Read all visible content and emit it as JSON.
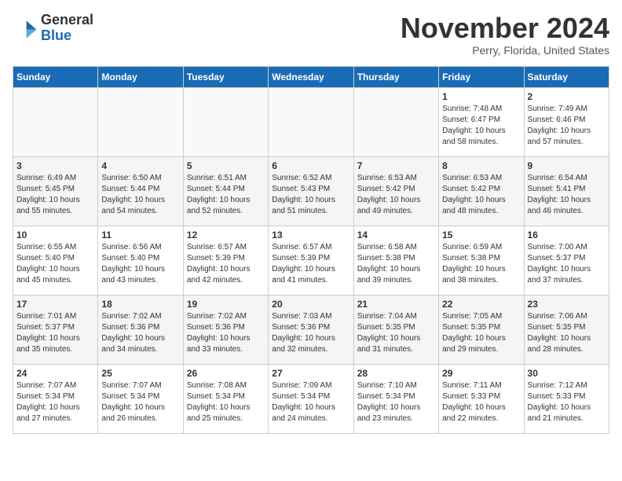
{
  "logo": {
    "general": "General",
    "blue": "Blue"
  },
  "title": "November 2024",
  "location": "Perry, Florida, United States",
  "days_of_week": [
    "Sunday",
    "Monday",
    "Tuesday",
    "Wednesday",
    "Thursday",
    "Friday",
    "Saturday"
  ],
  "weeks": [
    [
      {
        "day": "",
        "info": ""
      },
      {
        "day": "",
        "info": ""
      },
      {
        "day": "",
        "info": ""
      },
      {
        "day": "",
        "info": ""
      },
      {
        "day": "",
        "info": ""
      },
      {
        "day": "1",
        "info": "Sunrise: 7:48 AM\nSunset: 6:47 PM\nDaylight: 10 hours\nand 58 minutes."
      },
      {
        "day": "2",
        "info": "Sunrise: 7:49 AM\nSunset: 6:46 PM\nDaylight: 10 hours\nand 57 minutes."
      }
    ],
    [
      {
        "day": "3",
        "info": "Sunrise: 6:49 AM\nSunset: 5:45 PM\nDaylight: 10 hours\nand 55 minutes."
      },
      {
        "day": "4",
        "info": "Sunrise: 6:50 AM\nSunset: 5:44 PM\nDaylight: 10 hours\nand 54 minutes."
      },
      {
        "day": "5",
        "info": "Sunrise: 6:51 AM\nSunset: 5:44 PM\nDaylight: 10 hours\nand 52 minutes."
      },
      {
        "day": "6",
        "info": "Sunrise: 6:52 AM\nSunset: 5:43 PM\nDaylight: 10 hours\nand 51 minutes."
      },
      {
        "day": "7",
        "info": "Sunrise: 6:53 AM\nSunset: 5:42 PM\nDaylight: 10 hours\nand 49 minutes."
      },
      {
        "day": "8",
        "info": "Sunrise: 6:53 AM\nSunset: 5:42 PM\nDaylight: 10 hours\nand 48 minutes."
      },
      {
        "day": "9",
        "info": "Sunrise: 6:54 AM\nSunset: 5:41 PM\nDaylight: 10 hours\nand 46 minutes."
      }
    ],
    [
      {
        "day": "10",
        "info": "Sunrise: 6:55 AM\nSunset: 5:40 PM\nDaylight: 10 hours\nand 45 minutes."
      },
      {
        "day": "11",
        "info": "Sunrise: 6:56 AM\nSunset: 5:40 PM\nDaylight: 10 hours\nand 43 minutes."
      },
      {
        "day": "12",
        "info": "Sunrise: 6:57 AM\nSunset: 5:39 PM\nDaylight: 10 hours\nand 42 minutes."
      },
      {
        "day": "13",
        "info": "Sunrise: 6:57 AM\nSunset: 5:39 PM\nDaylight: 10 hours\nand 41 minutes."
      },
      {
        "day": "14",
        "info": "Sunrise: 6:58 AM\nSunset: 5:38 PM\nDaylight: 10 hours\nand 39 minutes."
      },
      {
        "day": "15",
        "info": "Sunrise: 6:59 AM\nSunset: 5:38 PM\nDaylight: 10 hours\nand 38 minutes."
      },
      {
        "day": "16",
        "info": "Sunrise: 7:00 AM\nSunset: 5:37 PM\nDaylight: 10 hours\nand 37 minutes."
      }
    ],
    [
      {
        "day": "17",
        "info": "Sunrise: 7:01 AM\nSunset: 5:37 PM\nDaylight: 10 hours\nand 35 minutes."
      },
      {
        "day": "18",
        "info": "Sunrise: 7:02 AM\nSunset: 5:36 PM\nDaylight: 10 hours\nand 34 minutes."
      },
      {
        "day": "19",
        "info": "Sunrise: 7:02 AM\nSunset: 5:36 PM\nDaylight: 10 hours\nand 33 minutes."
      },
      {
        "day": "20",
        "info": "Sunrise: 7:03 AM\nSunset: 5:36 PM\nDaylight: 10 hours\nand 32 minutes."
      },
      {
        "day": "21",
        "info": "Sunrise: 7:04 AM\nSunset: 5:35 PM\nDaylight: 10 hours\nand 31 minutes."
      },
      {
        "day": "22",
        "info": "Sunrise: 7:05 AM\nSunset: 5:35 PM\nDaylight: 10 hours\nand 29 minutes."
      },
      {
        "day": "23",
        "info": "Sunrise: 7:06 AM\nSunset: 5:35 PM\nDaylight: 10 hours\nand 28 minutes."
      }
    ],
    [
      {
        "day": "24",
        "info": "Sunrise: 7:07 AM\nSunset: 5:34 PM\nDaylight: 10 hours\nand 27 minutes."
      },
      {
        "day": "25",
        "info": "Sunrise: 7:07 AM\nSunset: 5:34 PM\nDaylight: 10 hours\nand 26 minutes."
      },
      {
        "day": "26",
        "info": "Sunrise: 7:08 AM\nSunset: 5:34 PM\nDaylight: 10 hours\nand 25 minutes."
      },
      {
        "day": "27",
        "info": "Sunrise: 7:09 AM\nSunset: 5:34 PM\nDaylight: 10 hours\nand 24 minutes."
      },
      {
        "day": "28",
        "info": "Sunrise: 7:10 AM\nSunset: 5:34 PM\nDaylight: 10 hours\nand 23 minutes."
      },
      {
        "day": "29",
        "info": "Sunrise: 7:11 AM\nSunset: 5:33 PM\nDaylight: 10 hours\nand 22 minutes."
      },
      {
        "day": "30",
        "info": "Sunrise: 7:12 AM\nSunset: 5:33 PM\nDaylight: 10 hours\nand 21 minutes."
      }
    ]
  ]
}
